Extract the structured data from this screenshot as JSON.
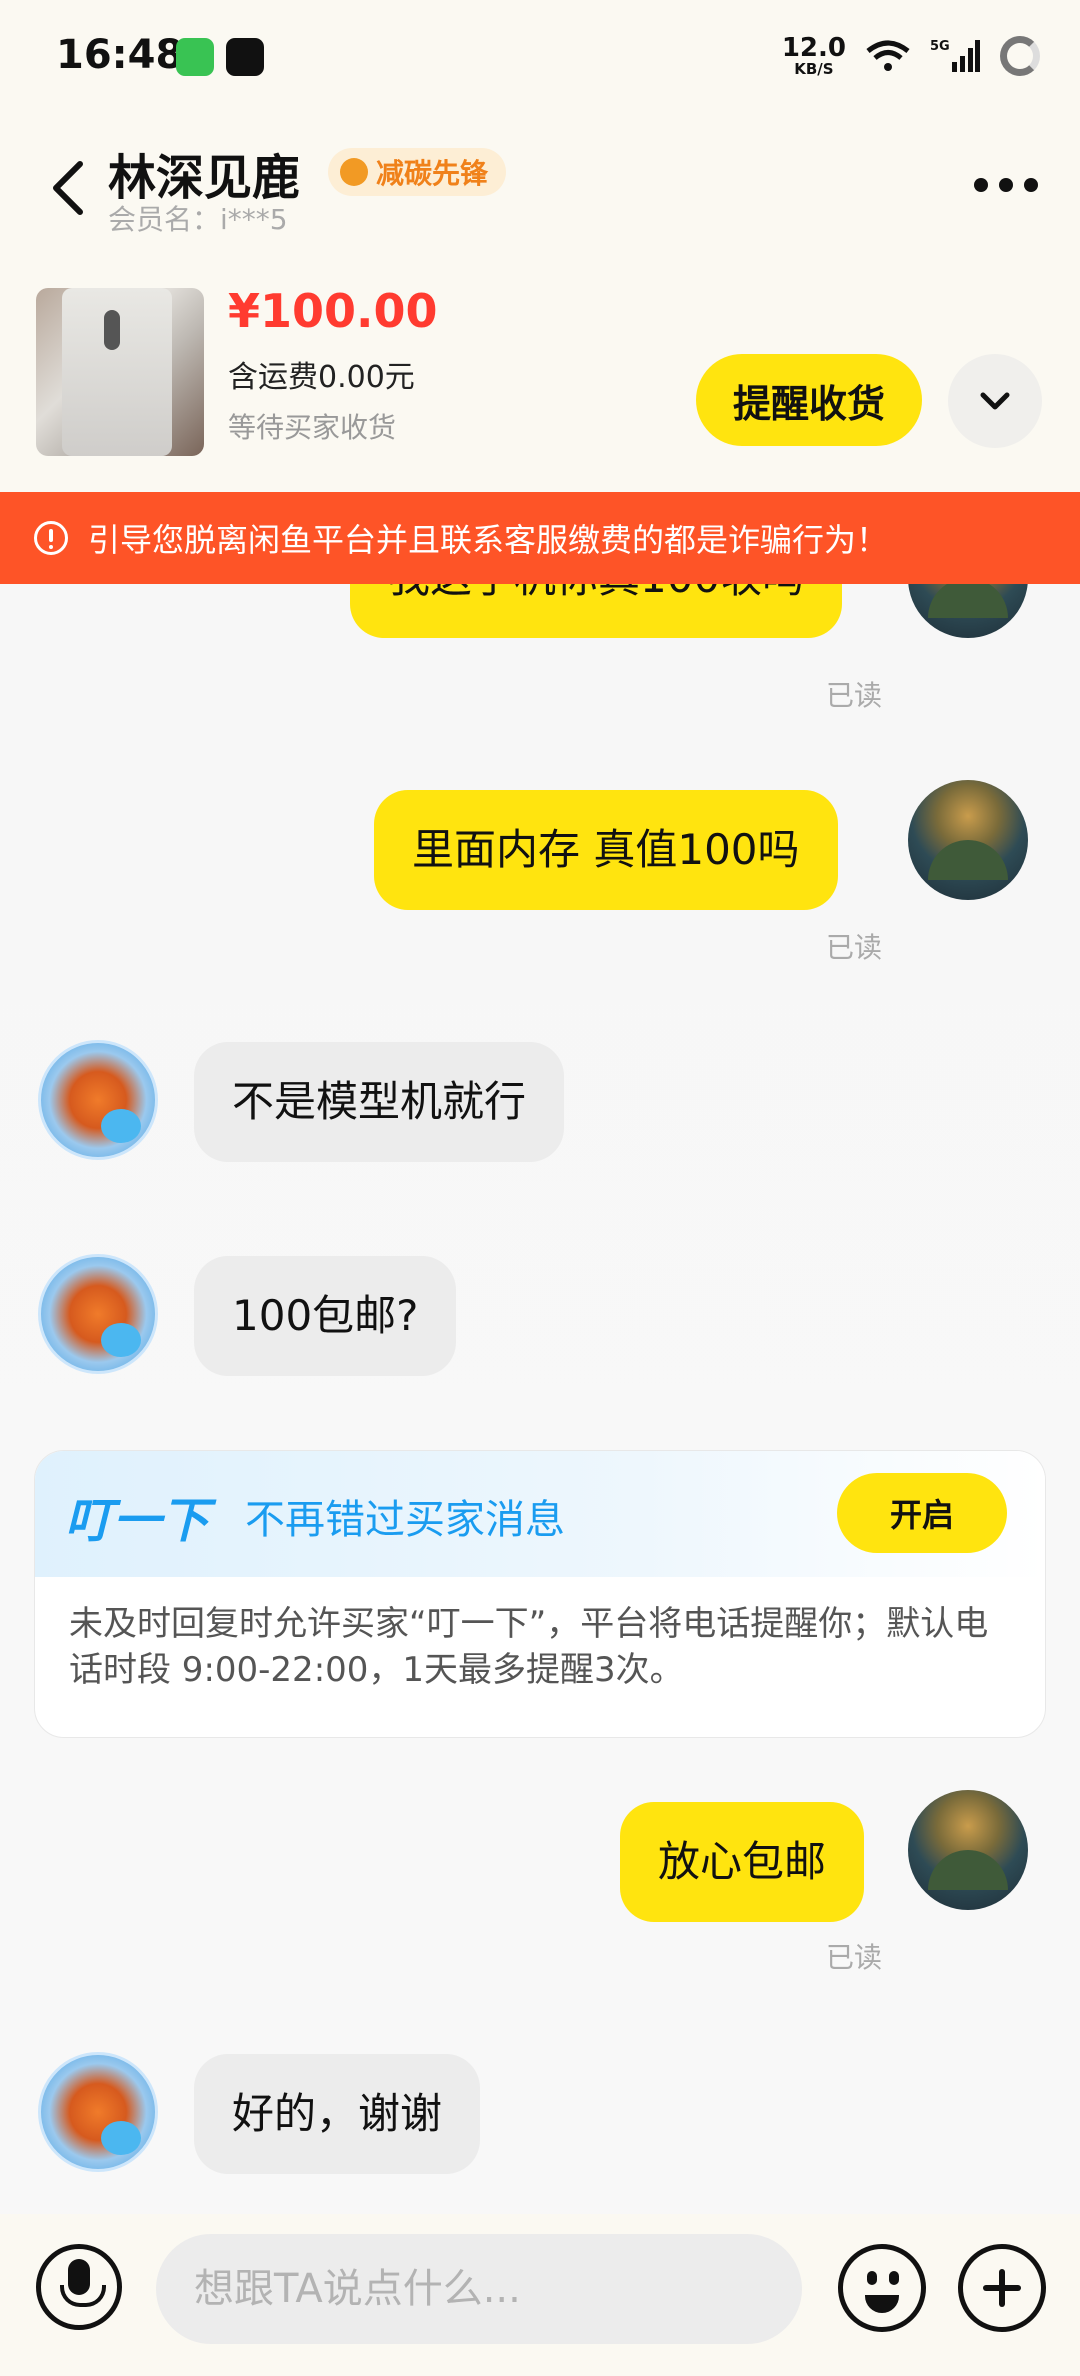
{
  "status_bar": {
    "time": "16:48",
    "net_speed_value": "12.0",
    "net_speed_unit": "KB/S",
    "network_type": "5G"
  },
  "header": {
    "title": "林深见鹿",
    "badge": "减碳先锋",
    "member": "会员名：i***5"
  },
  "product": {
    "price": "¥100.00",
    "shipping": "含运费0.00元",
    "status": "等待买家收货",
    "remind_button": "提醒收货"
  },
  "warning": "引导您脱离闲鱼平台并且联系客服缴费的都是诈骗行为！",
  "messages": [
    {
      "from": "me",
      "text": "我这手机你真100收吗",
      "read": "已读"
    },
    {
      "from": "me",
      "text": "里面内存  真值100吗",
      "read": "已读"
    },
    {
      "from": "them",
      "text": "不是模型机就行"
    },
    {
      "from": "them",
      "text": "100包邮?"
    },
    {
      "from": "me",
      "text": "放心包邮",
      "read": "已读"
    },
    {
      "from": "them",
      "text": "好的，谢谢"
    }
  ],
  "ding_card": {
    "logo": "叮一下",
    "subtitle": "不再错过买家消息",
    "button": "开启",
    "body": "未及时回复时允许买家“叮一下”，平台将电话提醒你；默认电话时段 9:00-22:00，1天最多提醒3次。"
  },
  "input": {
    "placeholder": "想跟TA说点什么..."
  },
  "colors": {
    "accent": "#ffe40f",
    "warning": "#fe5427",
    "price": "#ff3b30",
    "link_blue": "#1a9cf0"
  }
}
